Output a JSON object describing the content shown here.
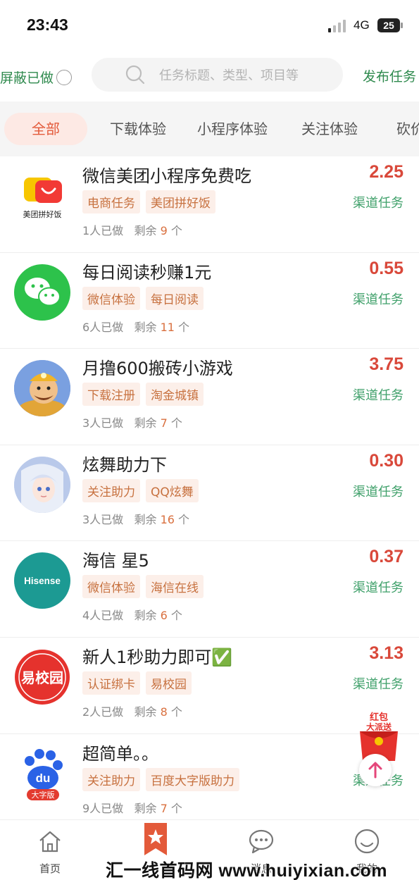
{
  "status_bar": {
    "time": "23:43",
    "network": "4G",
    "battery": "25"
  },
  "header": {
    "hide_done_label": "屏蔽已做",
    "search_placeholder": "任务标题、类型、项目等",
    "publish_label": "发布任务"
  },
  "tabs": [
    "全部",
    "下载体验",
    "小程序体验",
    "关注体验",
    "砍价"
  ],
  "tasks": [
    {
      "title": "微信美团小程序免费吃",
      "tags": [
        "电商任务",
        "美团拼好饭"
      ],
      "done": "1人已做",
      "remain_label": "剩余",
      "remain": "9",
      "unit": "个",
      "price": "2.25",
      "channel": "渠道任务",
      "logo_text": "美团拼好饭"
    },
    {
      "title": "每日阅读秒赚1元",
      "tags": [
        "微信体验",
        "每日阅读"
      ],
      "done": "6人已做",
      "remain_label": "剩余",
      "remain": "11",
      "unit": "个",
      "price": "0.55",
      "channel": "渠道任务"
    },
    {
      "title": "月撸600搬砖小游戏",
      "tags": [
        "下载注册",
        "淘金城镇"
      ],
      "done": "3人已做",
      "remain_label": "剩余",
      "remain": "7",
      "unit": "个",
      "price": "3.75",
      "channel": "渠道任务"
    },
    {
      "title": "炫舞助力下",
      "tags": [
        "关注助力",
        "QQ炫舞"
      ],
      "done": "3人已做",
      "remain_label": "剩余",
      "remain": "16",
      "unit": "个",
      "price": "0.30",
      "channel": "渠道任务"
    },
    {
      "title": "海信 星5",
      "tags": [
        "微信体验",
        "海信在线"
      ],
      "done": "4人已做",
      "remain_label": "剩余",
      "remain": "6",
      "unit": "个",
      "price": "0.37",
      "channel": "渠道任务",
      "logo_text": "Hisense"
    },
    {
      "title": "新人1秒助力即可✅",
      "tags": [
        "认证绑卡",
        "易校园"
      ],
      "done": "2人已做",
      "remain_label": "剩余",
      "remain": "8",
      "unit": "个",
      "price": "3.13",
      "channel": "渠道任务",
      "logo_text": "易校园"
    },
    {
      "title": "超简单。。",
      "tags": [
        "关注助力",
        "百度大字版助力"
      ],
      "done": "9人已做",
      "remain_label": "剩余",
      "remain": "7",
      "unit": "个",
      "price": "",
      "channel": "渠道任务",
      "logo_text": "du",
      "logo_subtext": "大字版"
    }
  ],
  "red_packet": {
    "line1": "红包",
    "line2": "大派送"
  },
  "bottom_nav": [
    {
      "label": "首页",
      "icon": "home-icon"
    },
    {
      "label": "",
      "icon": "star-bookmark-icon"
    },
    {
      "label": "消息",
      "icon": "message-icon"
    },
    {
      "label": "我的",
      "icon": "profile-icon"
    }
  ],
  "watermark": "汇一线首码网 www.huiyixian.com",
  "colors": {
    "accent_red": "#e35a3a",
    "price_red": "#d9483a",
    "green": "#2f8a4e",
    "tag_bg": "#fcefe9",
    "tag_text": "#c7713f"
  }
}
